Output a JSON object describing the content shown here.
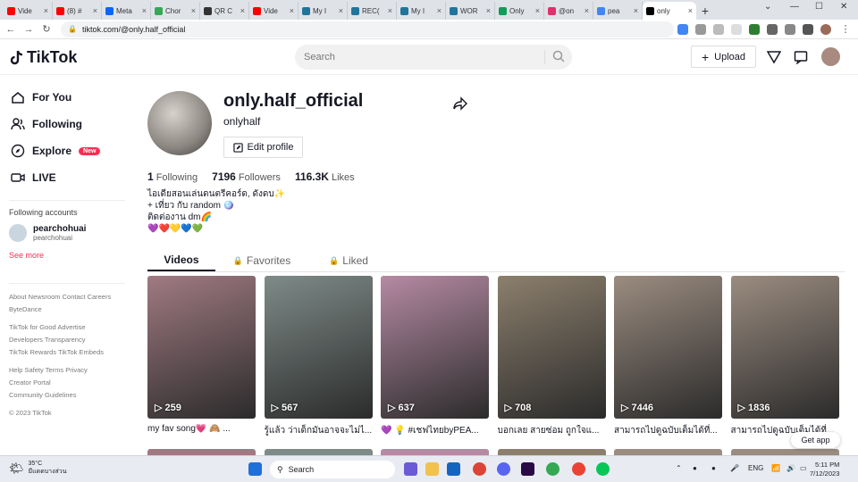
{
  "browser": {
    "tabs": [
      {
        "label": "Vide",
        "color": "#ff0000"
      },
      {
        "label": "(8) #",
        "color": "#ff0000"
      },
      {
        "label": "Meta",
        "color": "#0866ff"
      },
      {
        "label": "Chor",
        "color": "#34a853"
      },
      {
        "label": "QR C",
        "color": "#333333"
      },
      {
        "label": "Vide",
        "color": "#ff0000"
      },
      {
        "label": "My I",
        "color": "#21759b"
      },
      {
        "label": "REC(",
        "color": "#21759b"
      },
      {
        "label": "My I",
        "color": "#21759b"
      },
      {
        "label": "WOR",
        "color": "#21759b"
      },
      {
        "label": "Only",
        "color": "#0f9d58"
      },
      {
        "label": "@on",
        "color": "#e1306c"
      },
      {
        "label": "pea",
        "color": "#4285f4"
      },
      {
        "label": "only",
        "color": "#000000"
      }
    ],
    "url": "tiktok.com/@only.half_official"
  },
  "header": {
    "logo": "TikTok",
    "search_placeholder": "Search",
    "upload_label": "Upload"
  },
  "sidebar": {
    "nav": [
      {
        "label": "For You",
        "icon": "home-icon"
      },
      {
        "label": "Following",
        "icon": "users-icon"
      },
      {
        "label": "Explore",
        "icon": "compass-icon",
        "badge": "New"
      },
      {
        "label": "LIVE",
        "icon": "live-icon"
      }
    ],
    "following_title": "Following accounts",
    "account": {
      "name": "pearchohuai",
      "handle": "pearchohuai"
    },
    "see_more": "See more",
    "footer": [
      "About  Newsroom  Contact  Careers",
      "ByteDance",
      "TikTok for Good  Advertise",
      "Developers  Transparency",
      "TikTok Rewards  TikTok Embeds",
      "Help  Safety  Terms  Privacy",
      "Creator Portal",
      "Community Guidelines"
    ],
    "copyright": "© 2023 TikTok"
  },
  "profile": {
    "username": "only.half_official",
    "nickname": "onlyhalf",
    "edit_label": "Edit profile",
    "following_count": "1",
    "following_label": "Following",
    "followers_count": "7196",
    "followers_label": "Followers",
    "likes_count": "116.3K",
    "likes_label": "Likes",
    "bio": [
      "ไอเดียสอนเล่นดนตรีคอร์ด, ดังดบ✨",
      "+ เที่ยว กับ random 🪩",
      "ติดต่องาน dm🌈",
      "💜❤️💛💙💚"
    ]
  },
  "tabs": {
    "videos": "Videos",
    "favorites": "Favorites",
    "liked": "Liked"
  },
  "videos": [
    {
      "views": "259",
      "caption": "my fav song💗 🙈 ...",
      "bg": "#a07a82"
    },
    {
      "views": "567",
      "caption": "รู้แล้ว ว่าเด็กมันอาจจะไม่ไ...",
      "bg": "#7e8b88"
    },
    {
      "views": "637",
      "caption": "💜 💡 #เชฟไทยbyPEA...",
      "bg": "#b58aa3"
    },
    {
      "views": "708",
      "caption": "บอกเลย สายซ่อม ถูกใจแ...",
      "bg": "#8c7f6d"
    },
    {
      "views": "7446",
      "caption": "สามารถไปดูฉบับเต็มได้ที่...",
      "bg": "#9b8c80"
    },
    {
      "views": "1836",
      "caption": "สามารถไปดูฉบับเต็มได้ที่...",
      "bg": "#9b8c80"
    }
  ],
  "get_app": "Get app",
  "taskbar": {
    "temp": "35°C",
    "weather": "มีแดดบางส่วน",
    "search": "Search",
    "lang": "ENG",
    "time": "5:11 PM",
    "date": "7/12/2023"
  }
}
